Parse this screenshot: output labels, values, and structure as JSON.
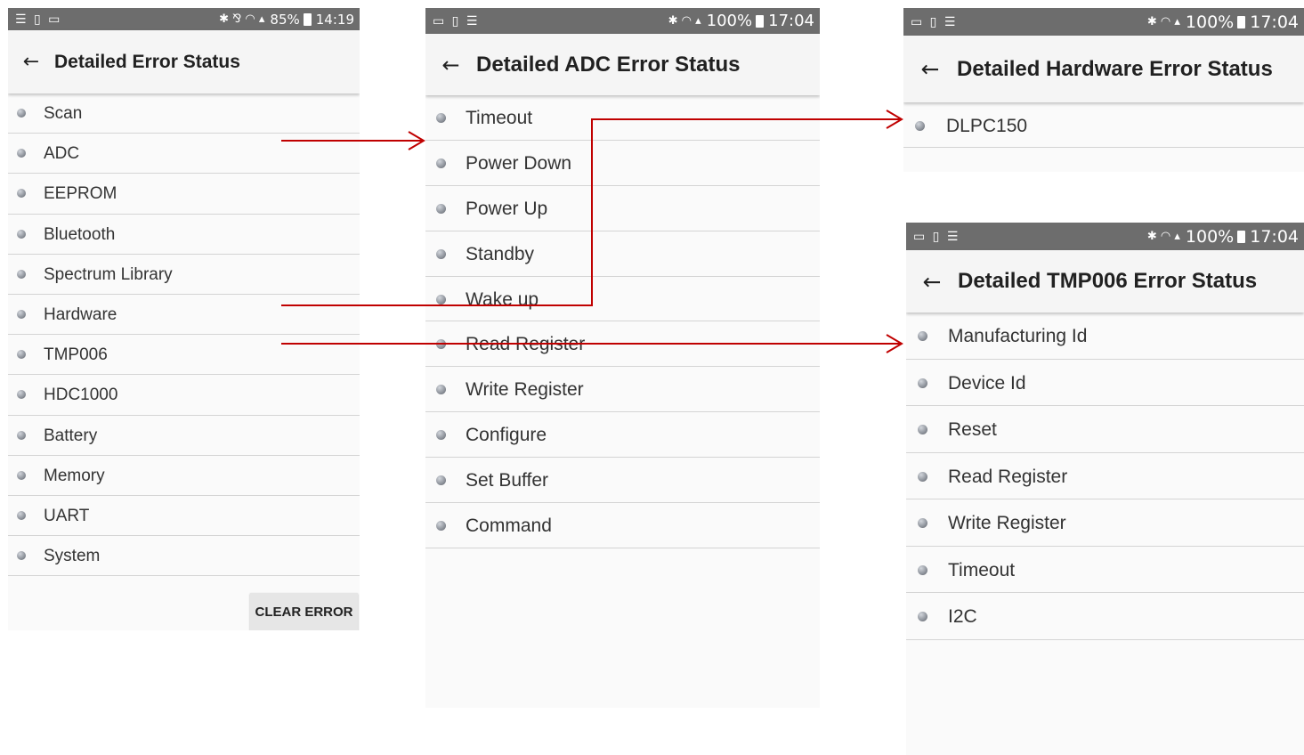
{
  "screens": [
    {
      "status": {
        "icons": "✱ ⅋ ◠ ▴",
        "battery": "85%",
        "time": "14:19",
        "left_icons": "☰ ▯ ▭"
      },
      "title": "Detailed Error Status",
      "items": [
        "Scan",
        "ADC",
        "EEPROM",
        "Bluetooth",
        "Spectrum Library",
        "Hardware",
        "TMP006",
        "HDC1000",
        "Battery",
        "Memory",
        "UART",
        "System"
      ],
      "button": "CLEAR ERROR"
    },
    {
      "status": {
        "icons": "✱ ◠ ▴",
        "battery": "100%",
        "time": "17:04",
        "left_icons": "▭ ▯ ☰"
      },
      "title": "Detailed ADC Error Status",
      "items": [
        "Timeout",
        "Power Down",
        "Power Up",
        "Standby",
        "Wake up",
        "Read Register",
        "Write Register",
        "Configure",
        "Set Buffer",
        "Command"
      ]
    },
    {
      "status": {
        "icons": "✱ ◠ ▴",
        "battery": "100%",
        "time": "17:04",
        "left_icons": "▭ ▯ ☰"
      },
      "title": "Detailed Hardware Error Status",
      "items": [
        "DLPC150"
      ]
    },
    {
      "status": {
        "icons": "✱ ◠ ▴",
        "battery": "100%",
        "time": "17:04",
        "left_icons": "▭ ▯ ☰"
      },
      "title": "Detailed TMP006 Error Status",
      "items": [
        "Manufacturing Id",
        "Device Id",
        "Reset",
        "Read Register",
        "Write Register",
        "Timeout",
        "I2C"
      ]
    }
  ],
  "annotation_color": "#c00000",
  "icons": {
    "back": "arrow-left-icon",
    "status_dot": "grey-led-icon"
  }
}
